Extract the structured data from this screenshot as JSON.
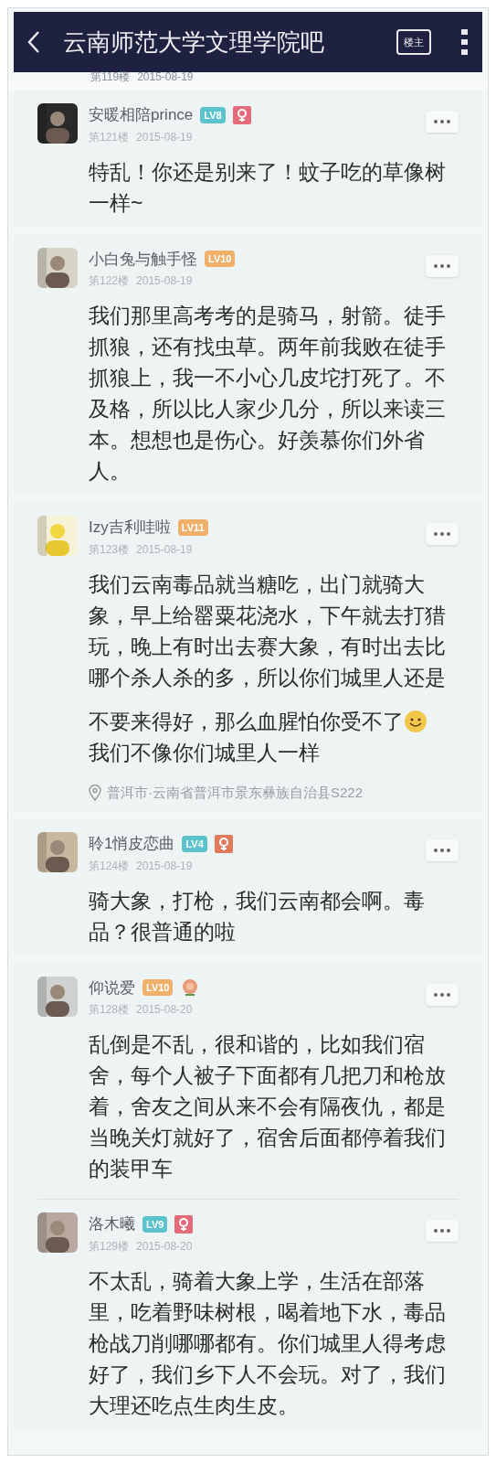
{
  "header": {
    "title": "云南师范大学文理学院吧",
    "owner_button": "楼主"
  },
  "partial_post": {
    "floor": "第119楼",
    "date": "2015-08-19"
  },
  "posts": [
    {
      "name": "安暖相陪prince",
      "badges": [
        {
          "kind": "level",
          "text": "LV8",
          "color": "#5cc3cc"
        },
        {
          "kind": "female",
          "color": "#e56a7a"
        }
      ],
      "floor": "第121楼",
      "date": "2015-08-19",
      "lines": [
        {
          "text": "特乱！你还是别来了！蚊子吃的草像树",
          "smiley": false
        },
        {
          "text": "一样~",
          "smiley": false
        }
      ],
      "divider": false
    },
    {
      "name": "小白兔与触手怪",
      "badges": [
        {
          "kind": "level",
          "text": "LV10",
          "color": "#f0b06a"
        }
      ],
      "floor": "第122楼",
      "date": "2015-08-19",
      "lines": [
        {
          "text": "我们那里高考考的是骑马，射箭。徒手",
          "smiley": false
        },
        {
          "text": "抓狼，还有找虫草。两年前我败在徒手",
          "smiley": false
        },
        {
          "text": "抓狼上，我一不小心几皮坨打死了。不",
          "smiley": false
        },
        {
          "text": "及格，所以比人家少几分，所以来读三",
          "smiley": false
        },
        {
          "text": "本。想想也是伤心。好羡慕你们外省",
          "smiley": false
        },
        {
          "text": "人。",
          "smiley": false
        }
      ],
      "divider": false
    },
    {
      "name": "Izy吉利哇啦",
      "badges": [
        {
          "kind": "level",
          "text": "LV11",
          "color": "#f0b06a"
        }
      ],
      "floor": "第123楼",
      "date": "2015-08-19",
      "lines": [
        {
          "text": "我们云南毒品就当糖吃，出门就骑大",
          "smiley": false
        },
        {
          "text": "象，早上给罂粟花浇水，下午就去打猎",
          "smiley": false
        },
        {
          "text": "玩，晚上有时出去赛大象，有时出去比",
          "smiley": false
        },
        {
          "text": "哪个杀人杀的多，所以你们城里人还是",
          "smiley": false
        },
        {
          "text": "不要来得好，那么血腥怕你受不了",
          "smiley": true
        },
        {
          "text": "我们不像你们城里人一样",
          "smiley": false
        }
      ],
      "location": "普洱市·云南省普洱市景东彝族自治县S222",
      "divider": false
    },
    {
      "name": "聆1悄皮恋曲",
      "badges": [
        {
          "kind": "level",
          "text": "LV4",
          "color": "#5cc3cc"
        },
        {
          "kind": "female",
          "color": "#e07a5a"
        }
      ],
      "floor": "第124楼",
      "date": "2015-08-19",
      "lines": [
        {
          "text": "骑大象，打枪，我们云南都会啊。毒",
          "smiley": false
        },
        {
          "text": "品？很普通的啦",
          "smiley": false
        }
      ],
      "divider": false
    },
    {
      "name": "仰说爱",
      "badges": [
        {
          "kind": "level",
          "text": "LV10",
          "color": "#f0b06a"
        },
        {
          "kind": "medal",
          "color": "#e89a7a"
        }
      ],
      "floor": "第128楼",
      "date": "2015-08-20",
      "lines": [
        {
          "text": "乱倒是不乱，很和谐的，比如我们宿",
          "smiley": false
        },
        {
          "text": "舍，每个人被子下面都有几把刀和枪放",
          "smiley": false
        },
        {
          "text": "着，舍友之间从来不会有隔夜仇，都是",
          "smiley": false
        },
        {
          "text": "当晚关灯就好了，宿舍后面都停着我们",
          "smiley": false
        },
        {
          "text": "的装甲车",
          "smiley": false
        }
      ],
      "divider": true
    },
    {
      "name": "洛木曦",
      "badges": [
        {
          "kind": "level",
          "text": "LV9",
          "color": "#5cc3cc"
        },
        {
          "kind": "female",
          "color": "#e56a7a"
        }
      ],
      "floor": "第129楼",
      "date": "2015-08-20",
      "lines": [
        {
          "text": "不太乱，骑着大象上学，生活在部落",
          "smiley": false
        },
        {
          "text": "里，吃着野味树根，喝着地下水，毒品",
          "smiley": false
        },
        {
          "text": "枪战刀削哪哪都有。你们城里人得考虑",
          "smiley": false
        },
        {
          "text": "好了，我们乡下人不会玩。对了，我们",
          "smiley": false
        },
        {
          "text": "大理还吃点生肉生皮。",
          "smiley": false
        }
      ],
      "divider": false
    }
  ]
}
